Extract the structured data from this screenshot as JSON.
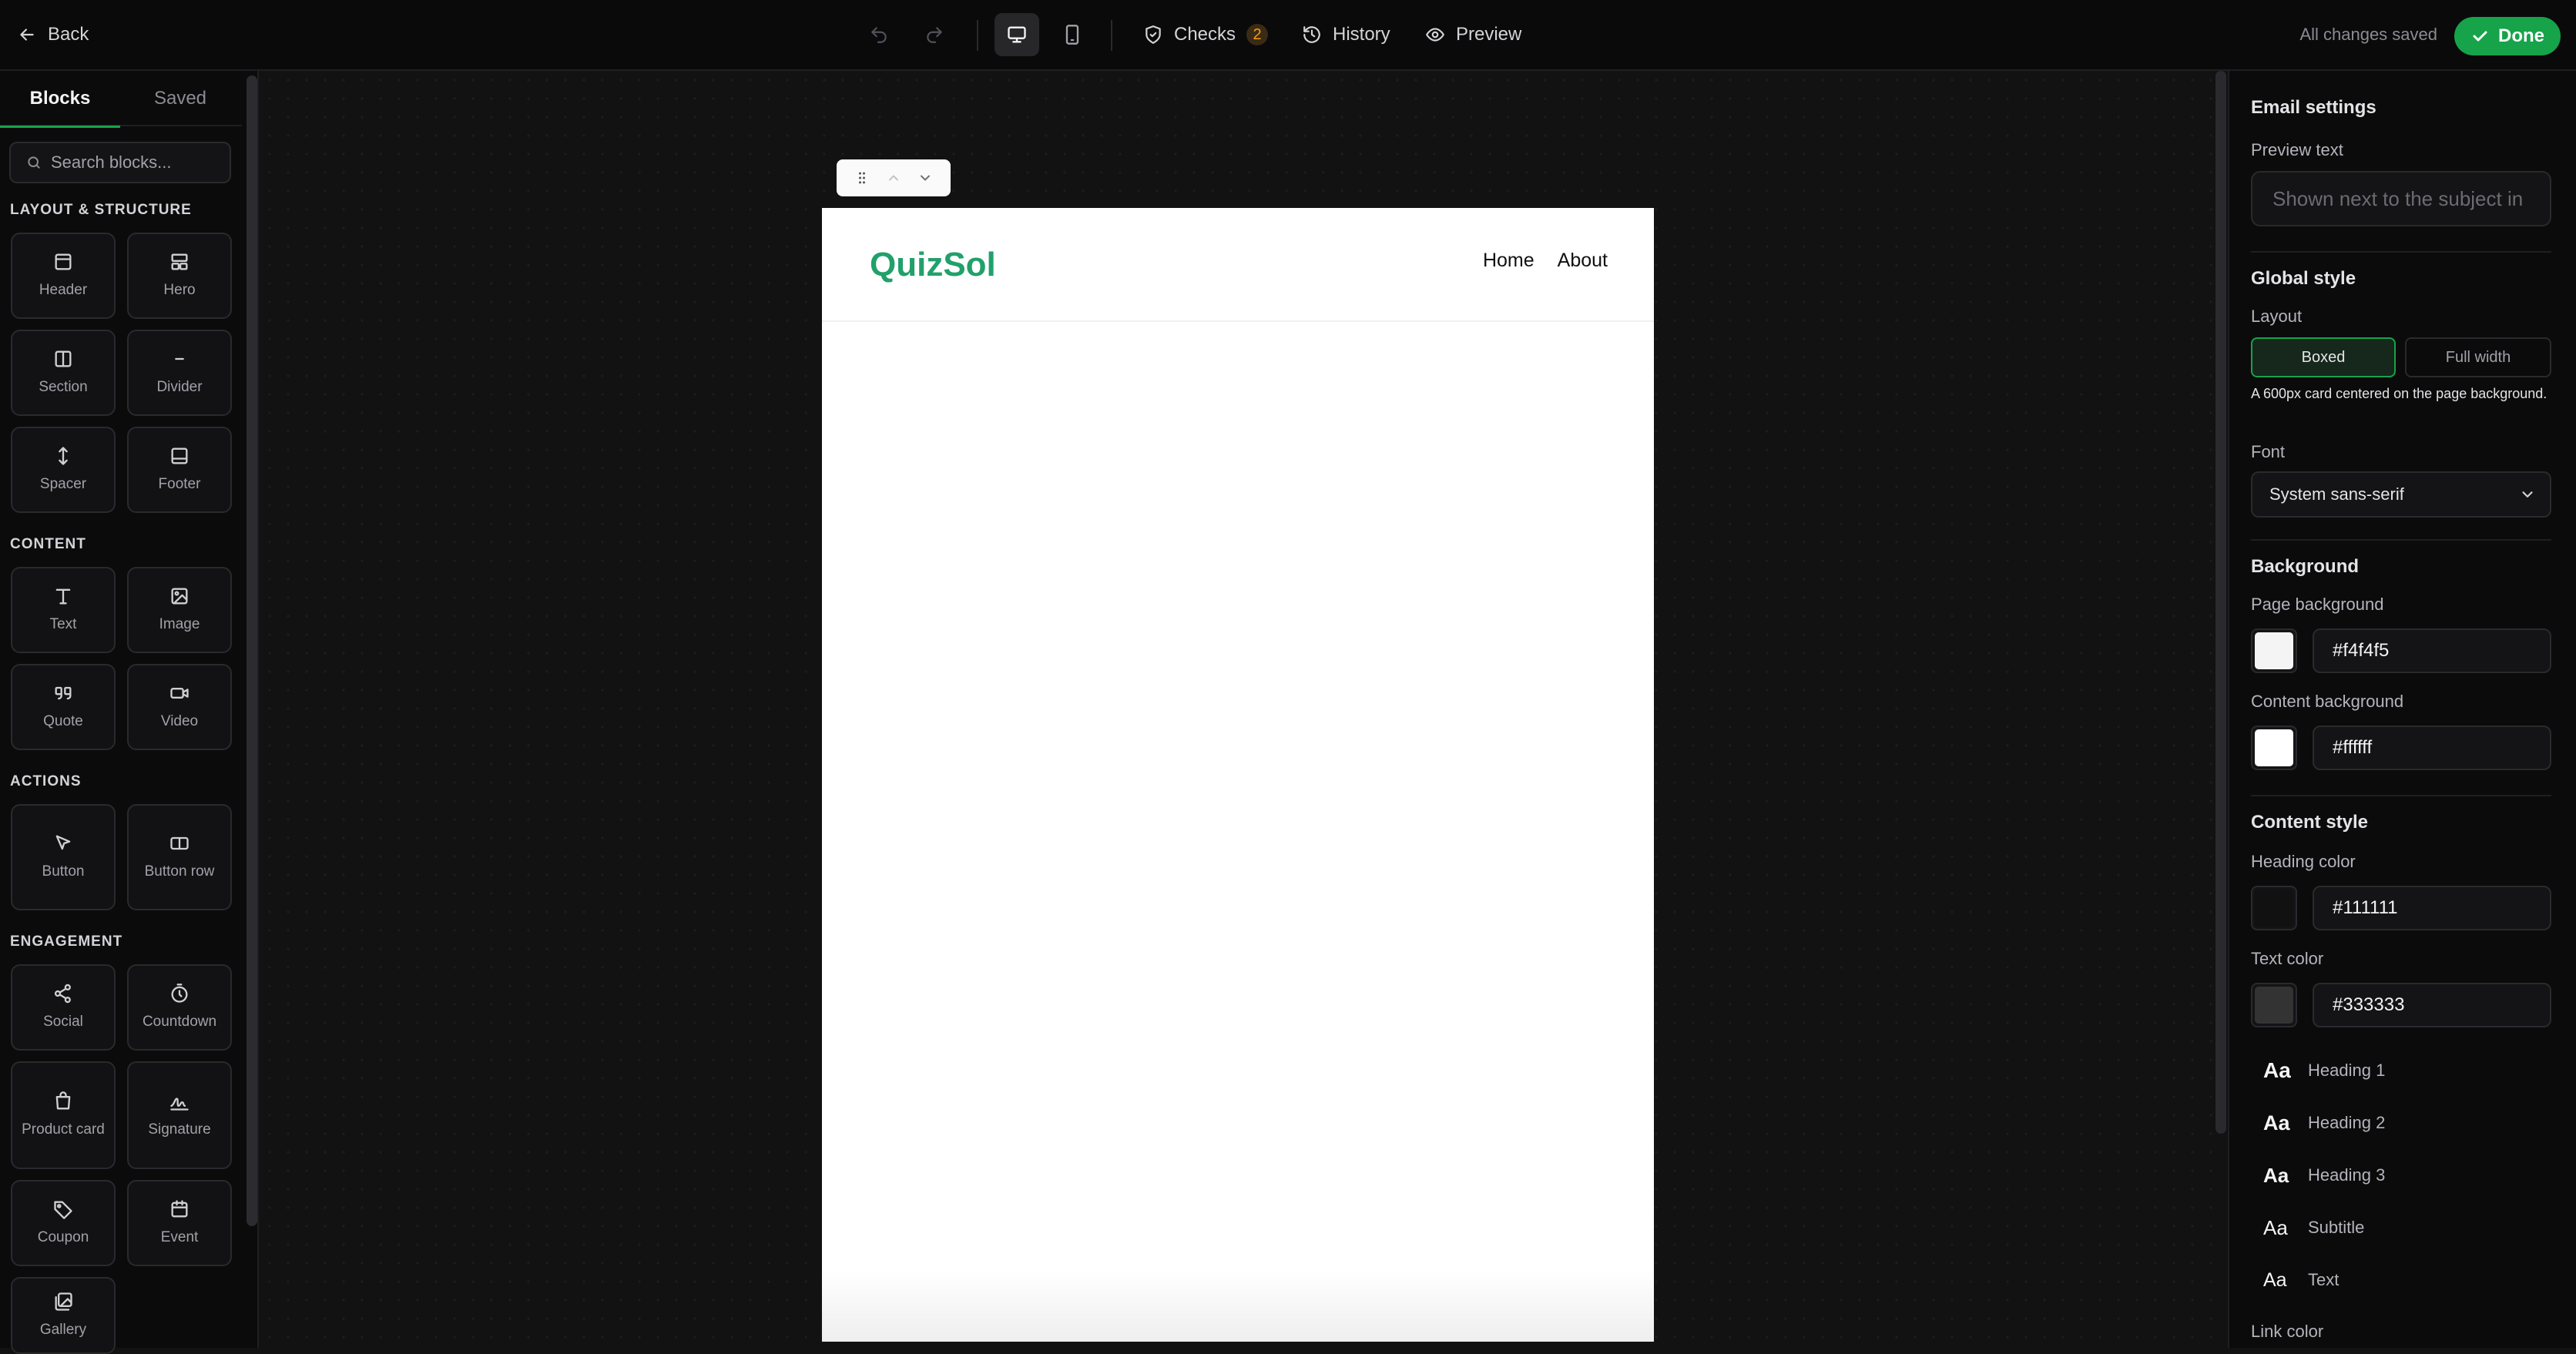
{
  "topbar": {
    "back_label": "Back",
    "checks_label": "Checks",
    "checks_count": "2",
    "history_label": "History",
    "preview_label": "Preview",
    "saved_status": "All changes saved",
    "done_label": "Done"
  },
  "sidebar": {
    "tabs": [
      {
        "label": "Blocks"
      },
      {
        "label": "Saved"
      }
    ],
    "active_tab": "Blocks",
    "search_placeholder": "Search blocks...",
    "categories": [
      {
        "title": "LAYOUT & STRUCTURE",
        "blocks": [
          {
            "label": "Header",
            "icon": "header-icon"
          },
          {
            "label": "Hero",
            "icon": "hero-icon"
          },
          {
            "label": "Section",
            "icon": "section-icon"
          },
          {
            "label": "Divider",
            "icon": "divider-icon"
          },
          {
            "label": "Spacer",
            "icon": "spacer-icon"
          },
          {
            "label": "Footer",
            "icon": "footer-icon"
          }
        ]
      },
      {
        "title": "CONTENT",
        "blocks": [
          {
            "label": "Text",
            "icon": "text-icon"
          },
          {
            "label": "Image",
            "icon": "image-icon"
          },
          {
            "label": "Quote",
            "icon": "quote-icon"
          },
          {
            "label": "Video",
            "icon": "video-icon"
          }
        ]
      },
      {
        "title": "ACTIONS",
        "blocks": [
          {
            "label": "Button",
            "icon": "pointer-icon"
          },
          {
            "label": "Button row",
            "icon": "button-row-icon"
          }
        ]
      },
      {
        "title": "ENGAGEMENT",
        "blocks": [
          {
            "label": "Social",
            "icon": "share-icon"
          },
          {
            "label": "Countdown",
            "icon": "timer-icon"
          },
          {
            "label": "Product card",
            "icon": "shopping-bag-icon"
          },
          {
            "label": "Signature",
            "icon": "signature-icon"
          },
          {
            "label": "Coupon",
            "icon": "tag-icon"
          },
          {
            "label": "Event",
            "icon": "calendar-icon"
          },
          {
            "label": "Gallery",
            "icon": "gallery-icon"
          }
        ]
      }
    ]
  },
  "canvas": {
    "email": {
      "logo_text": "QuizSol",
      "logo_color": "#22a06b",
      "nav": [
        {
          "label": "Home"
        },
        {
          "label": "About"
        }
      ]
    }
  },
  "settings": {
    "title": "Email settings",
    "preview_text": {
      "label": "Preview text",
      "placeholder": "Shown next to the subject in",
      "value": ""
    },
    "global_style": {
      "title": "Global style",
      "layout_label": "Layout",
      "layout_options": [
        {
          "label": "Boxed"
        },
        {
          "label": "Full width"
        }
      ],
      "layout_selected": "Boxed",
      "layout_note": "A 600px card centered on the page background.",
      "font_label": "Font",
      "font_value": "System sans-serif"
    },
    "background": {
      "title": "Background",
      "page_label": "Page background",
      "page_value": "#f4f4f5",
      "content_label": "Content background",
      "content_value": "#ffffff"
    },
    "content_style": {
      "title": "Content style",
      "heading_color_label": "Heading color",
      "heading_color_value": "#111111",
      "text_color_label": "Text color",
      "text_color_value": "#333333",
      "typography": [
        {
          "sample": "Aa",
          "label": "Heading 1"
        },
        {
          "sample": "Aa",
          "label": "Heading 2"
        },
        {
          "sample": "Aa",
          "label": "Heading 3"
        },
        {
          "sample": "Aa",
          "label": "Subtitle"
        },
        {
          "sample": "Aa",
          "label": "Text"
        }
      ],
      "link_color_label": "Link color"
    }
  },
  "colors": {
    "accent": "#16a34a",
    "warning": "#f59e0b"
  }
}
